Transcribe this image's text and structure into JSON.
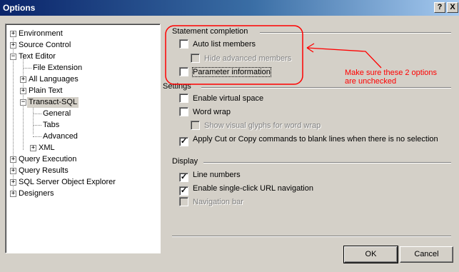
{
  "window": {
    "title": "Options",
    "help_label": "?",
    "close_label": "X"
  },
  "tree": {
    "items": [
      {
        "label": "Environment",
        "expander": "+"
      },
      {
        "label": "Source Control",
        "expander": "+"
      },
      {
        "label": "Text Editor",
        "expander": "−"
      },
      {
        "label": "File Extension",
        "expander": ""
      },
      {
        "label": "All Languages",
        "expander": "+"
      },
      {
        "label": "Plain Text",
        "expander": "+"
      },
      {
        "label": "Transact-SQL",
        "expander": "−"
      },
      {
        "label": "General",
        "expander": ""
      },
      {
        "label": "Tabs",
        "expander": ""
      },
      {
        "label": "Advanced",
        "expander": ""
      },
      {
        "label": "XML",
        "expander": "+"
      },
      {
        "label": "Query Execution",
        "expander": "+"
      },
      {
        "label": "Query Results",
        "expander": "+"
      },
      {
        "label": "SQL Server Object Explorer",
        "expander": "+"
      },
      {
        "label": "Designers",
        "expander": "+"
      }
    ]
  },
  "statement_completion": {
    "header": "Statement completion",
    "auto_list_members": {
      "label": "Auto list members",
      "checked": false
    },
    "hide_advanced_members": {
      "label": "Hide advanced members",
      "checked": false,
      "enabled": false
    },
    "parameter_information": {
      "label": "Parameter information",
      "checked": false
    }
  },
  "settings": {
    "header": "Settings",
    "enable_virtual_space": {
      "label": "Enable virtual space",
      "checked": false
    },
    "word_wrap": {
      "label": "Word wrap",
      "checked": false
    },
    "show_visual_glyphs": {
      "label": "Show visual glyphs for word wrap",
      "checked": false,
      "enabled": false
    },
    "apply_cut_copy": {
      "label": "Apply Cut or Copy commands to blank lines when there is no selection",
      "checked": true
    }
  },
  "display": {
    "header": "Display",
    "line_numbers": {
      "label": "Line numbers",
      "checked": true
    },
    "single_click_url": {
      "label": "Enable single-click URL navigation",
      "checked": true
    },
    "navigation_bar": {
      "label": "Navigation bar",
      "checked": false,
      "enabled": false
    }
  },
  "annotation": {
    "line1": "Make sure these 2 options",
    "line2": "are unchecked",
    "color": "#ff0000"
  },
  "buttons": {
    "ok_label": "OK",
    "cancel_label": "Cancel"
  },
  "check_mark": "✓"
}
